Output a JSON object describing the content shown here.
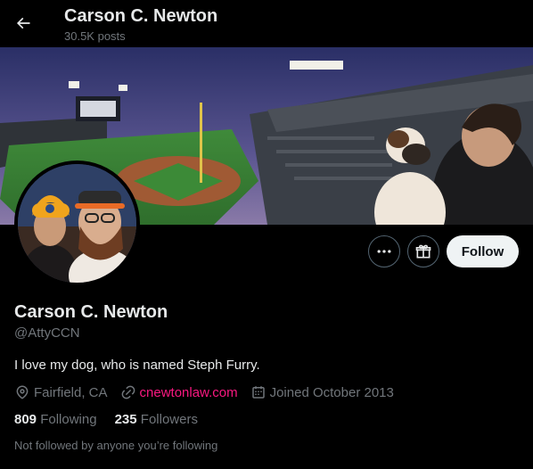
{
  "header": {
    "name": "Carson C. Newton",
    "posts_count": "30.5K posts"
  },
  "banner": {
    "description_icon": "stadium-banner-photo"
  },
  "avatar": {
    "icon": "profile-avatar-photo"
  },
  "actions": {
    "more_icon": "more-dots-icon",
    "gift_icon": "gift-icon",
    "follow_label": "Follow"
  },
  "profile": {
    "display_name": "Carson C. Newton",
    "handle": "@AttyCCN",
    "bio": "I love my dog, who is named Steph Furry.",
    "location": "Fairfield, CA",
    "website": "cnewtonlaw.com",
    "joined": "Joined October 2013"
  },
  "stats": {
    "following_count": "809",
    "following_label": "Following",
    "followers_count": "235",
    "followers_label": "Followers"
  },
  "footer": {
    "not_followed_text": "Not followed by anyone you’re following"
  },
  "colors": {
    "background": "#000000",
    "text_primary": "#e7e9ea",
    "text_secondary": "#71767b",
    "link": "#f91880",
    "follow_bg": "#eff3f4"
  }
}
